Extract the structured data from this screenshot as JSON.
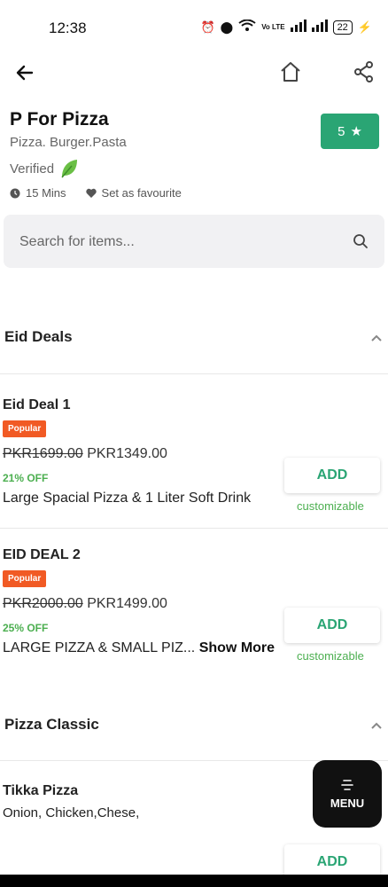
{
  "status": {
    "time": "12:38",
    "network": "Vo LTE",
    "battery": "22"
  },
  "nav": {
    "back_icon": "arrow-left-icon",
    "home_icon": "home-icon",
    "share_icon": "share-icon"
  },
  "restaurant": {
    "name": "P For Pizza",
    "categories": "Pizza. Burger.Pasta",
    "verified": "Verified",
    "rating": "5",
    "time": "15 Mins",
    "favourite": "Set as favourite"
  },
  "search": {
    "placeholder": "Search for items..."
  },
  "sections": [
    {
      "title": "Eid Deals",
      "items": [
        {
          "name": "Eid Deal 1",
          "badge": "Popular",
          "old_price": "PKR1699.00",
          "price": "PKR1349.00",
          "discount": "21% OFF",
          "description": "Large Spacial Pizza & 1 Liter Soft Drink",
          "add": "ADD",
          "customizable": "customizable"
        },
        {
          "name": "EID DEAL 2",
          "badge": "Popular",
          "old_price": "PKR2000.00",
          "price": "PKR1499.00",
          "discount": "25% OFF",
          "description": "LARGE PIZZA & SMALL PIZ...",
          "show_more": "Show More",
          "add": "ADD",
          "customizable": "customizable"
        }
      ]
    },
    {
      "title": "Pizza Classic",
      "items": [
        {
          "name": "Tikka Pizza",
          "description": "Onion, Chicken,Chese,",
          "add": "ADD"
        }
      ]
    }
  ],
  "menu_button": {
    "label": "MENU"
  },
  "colors": {
    "accent": "#2aa574",
    "badge": "#f15a24",
    "discount": "#4caf50"
  }
}
